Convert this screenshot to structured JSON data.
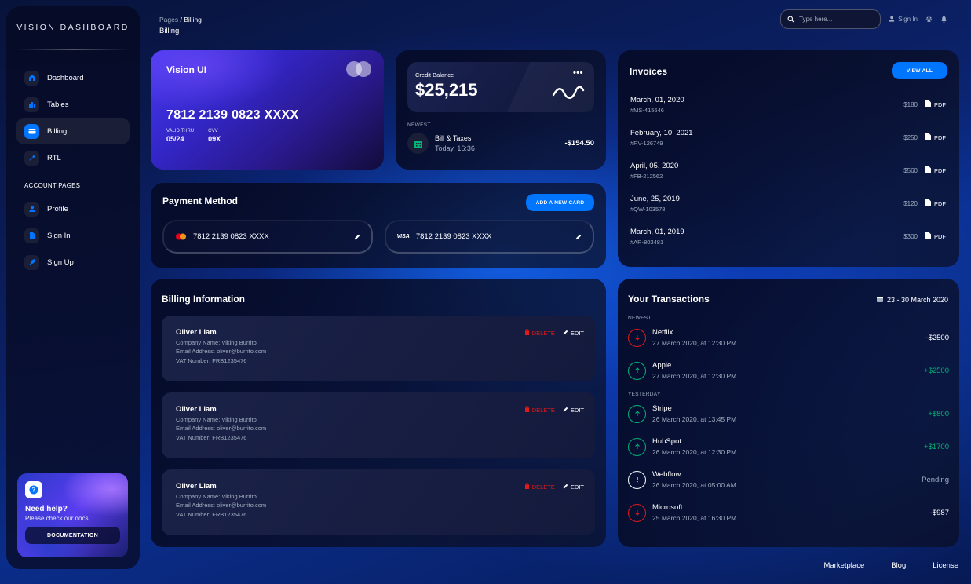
{
  "sidebar": {
    "brand": "VISION DASHBOARD",
    "items": [
      {
        "label": "Dashboard",
        "icon": "home-icon"
      },
      {
        "label": "Tables",
        "icon": "chart-icon"
      },
      {
        "label": "Billing",
        "icon": "credit-card-icon",
        "active": true
      },
      {
        "label": "RTL",
        "icon": "wrench-icon"
      }
    ],
    "account_section": "ACCOUNT PAGES",
    "account_items": [
      {
        "label": "Profile",
        "icon": "person-icon"
      },
      {
        "label": "Sign In",
        "icon": "document-icon"
      },
      {
        "label": "Sign Up",
        "icon": "rocket-icon"
      }
    ],
    "help": {
      "title": "Need help?",
      "subtitle": "Please check our docs",
      "button": "DOCUMENTATION"
    }
  },
  "header": {
    "breadcrumb_parent": "Pages",
    "breadcrumb_current": "Billing",
    "title": "Billing",
    "search_placeholder": "Type here...",
    "signin": "Sign In"
  },
  "credit_card": {
    "brand": "Vision UI",
    "number": "7812 2139 0823 XXXX",
    "valid_label": "VALID THRU",
    "valid_value": "05/24",
    "cvv_label": "CVV",
    "cvv_value": "09X"
  },
  "balance": {
    "label": "Credit Balance",
    "amount": "$25,215",
    "newest_label": "NEWEST",
    "bill_name": "Bill & Taxes",
    "bill_time": "Today, 16:36",
    "bill_amount": "-$154.50"
  },
  "payment": {
    "title": "Payment Method",
    "add_button": "ADD A NEW CARD",
    "cards": [
      {
        "brand": "mastercard",
        "number": "7812 2139 0823 XXXX"
      },
      {
        "brand": "VISA",
        "number": "7812 2139 0823 XXXX"
      }
    ]
  },
  "invoices": {
    "title": "Invoices",
    "view_all": "VIEW ALL",
    "pdf_label": "PDF",
    "items": [
      {
        "date": "March, 01, 2020",
        "id": "#MS-415646",
        "price": "$180"
      },
      {
        "date": "February, 10, 2021",
        "id": "#RV-126749",
        "price": "$250"
      },
      {
        "date": "April, 05, 2020",
        "id": "#FB-212562",
        "price": "$560"
      },
      {
        "date": "June, 25, 2019",
        "id": "#QW-103578",
        "price": "$120"
      },
      {
        "date": "March, 01, 2019",
        "id": "#AR-803481",
        "price": "$300"
      }
    ]
  },
  "billing_info": {
    "title": "Billing Information",
    "delete_label": "DELETE",
    "edit_label": "EDIT",
    "items": [
      {
        "name": "Oliver Liam",
        "company": "Company Name: Viking Burrito",
        "email": "Email Address: oliver@burrito.com",
        "vat": "VAT Number: FRB1235476"
      },
      {
        "name": "Oliver Liam",
        "company": "Company Name: Viking Burrito",
        "email": "Email Address: oliver@burrito.com",
        "vat": "VAT Number: FRB1235476"
      },
      {
        "name": "Oliver Liam",
        "company": "Company Name: Viking Burrito",
        "email": "Email Address: oliver@burrito.com",
        "vat": "VAT Number: FRB1235476"
      }
    ]
  },
  "transactions": {
    "title": "Your Transactions",
    "range": "23 - 30 March 2020",
    "newest_label": "NEWEST",
    "yesterday_label": "YESTERDAY",
    "newest": [
      {
        "name": "Netflix",
        "time": "27 March 2020, at 12:30 PM",
        "amount": "-$2500",
        "kind": "down"
      },
      {
        "name": "Apple",
        "time": "27 March 2020, at 12:30 PM",
        "amount": "+$2500",
        "kind": "up"
      }
    ],
    "yesterday": [
      {
        "name": "Stripe",
        "time": "26 March 2020, at 13:45 PM",
        "amount": "+$800",
        "kind": "up"
      },
      {
        "name": "HubSpot",
        "time": "26 March 2020, at 12:30 PM",
        "amount": "+$1700",
        "kind": "up"
      },
      {
        "name": "Webflow",
        "time": "26 March 2020, at 05:00 AM",
        "amount": "Pending",
        "kind": "pending"
      },
      {
        "name": "Microsoft",
        "time": "25 March 2020, at 16:30 PM",
        "amount": "-$987",
        "kind": "down"
      }
    ]
  },
  "footer": {
    "links": [
      "Marketplace",
      "Blog",
      "License"
    ]
  },
  "colors": {
    "accent": "#0075ff",
    "positive": "#01b574",
    "negative": "#e31a1a",
    "muted": "#a0aec0"
  }
}
